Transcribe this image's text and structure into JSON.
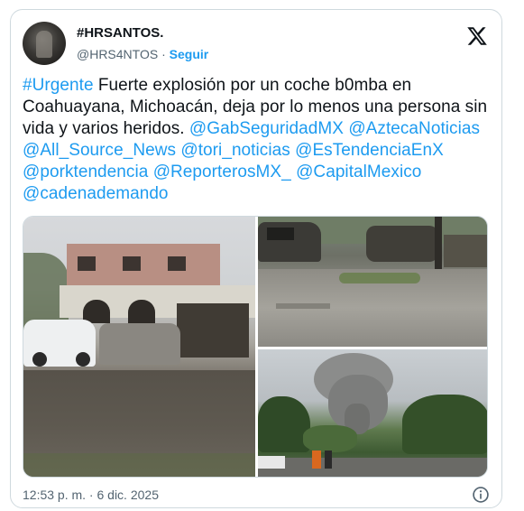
{
  "author": {
    "display_name": "#HRSANTOS.",
    "handle": "@HRS4NTOS",
    "separator": "·",
    "follow_label": "Seguir"
  },
  "tweet": {
    "hashtag": "#Urgente",
    "text": " Fuerte explosión por un coche b0mba en Coahuayana, Michoacán, deja por lo menos una persona sin vida y varios heridos.  ",
    "mentions": [
      "@GabSeguridadMX",
      "@AztecaNoticias",
      "@All_Source_News",
      "@tori_noticias",
      "@EsTendenciaEnX",
      "@porktendencia",
      "@ReporterosMX_",
      "@CapitalMexico",
      "@cadenademando"
    ]
  },
  "timestamp": "12:53 p. m. · 6 dic. 2025",
  "icons": {
    "platform": "x-logo-icon",
    "info": "info-icon"
  },
  "colors": {
    "link": "#1d9bf0",
    "text": "#0f1419",
    "secondary": "#536471",
    "border": "#cfd9de"
  }
}
